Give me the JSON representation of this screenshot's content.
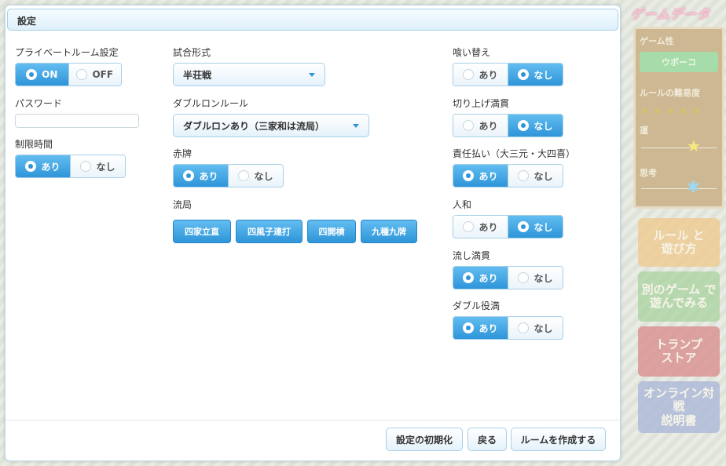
{
  "dialog": {
    "title": "設定"
  },
  "left": {
    "private_room": {
      "label": "プライベートルーム設定",
      "on": "ON",
      "off": "OFF",
      "selected": "ON"
    },
    "password": {
      "label": "パスワード",
      "value": "",
      "placeholder": ""
    },
    "time_limit": {
      "label": "制限時間",
      "yes": "あり",
      "no": "なし",
      "selected": "あり"
    }
  },
  "middle": {
    "match_format": {
      "label": "試合形式",
      "value": "半荘戦"
    },
    "double_ron": {
      "label": "ダブルロンルール",
      "value": "ダブルロンあり（三家和は流局）"
    },
    "red_tiles": {
      "label": "赤牌",
      "yes": "あり",
      "no": "なし",
      "selected": "あり"
    },
    "abortive_draw": {
      "label": "流局",
      "options": [
        "四家立直",
        "四風子連打",
        "四開槓",
        "九種九牌"
      ]
    }
  },
  "right": {
    "kuikae": {
      "label": "喰い替え",
      "yes": "あり",
      "no": "なし",
      "selected": "なし"
    },
    "kiriage_mangan": {
      "label": "切り上げ満貫",
      "yes": "あり",
      "no": "なし",
      "selected": "なし"
    },
    "liability": {
      "label": "責任払い（大三元・大四喜）",
      "yes": "あり",
      "no": "なし",
      "selected": "あり"
    },
    "renhou": {
      "label": "人和",
      "yes": "あり",
      "no": "なし",
      "selected": "なし"
    },
    "nagashi_mangan": {
      "label": "流し満貫",
      "yes": "あり",
      "no": "なし",
      "selected": "あり"
    },
    "double_yakuman": {
      "label": "ダブル役満",
      "yes": "あり",
      "no": "なし",
      "selected": "あり"
    }
  },
  "footer": {
    "reset": "設定の初期化",
    "back": "戻る",
    "create": "ルームを作成する"
  },
  "sidebar": {
    "title": "ゲームデータ",
    "game_type_label": "ゲーム性",
    "game_type_value": "ウボーコ",
    "rule_difficulty_label": "ルールの難易度",
    "stars": "★★★★★",
    "luck_label": "運",
    "thinking_label": "思考",
    "nav": [
      {
        "line1": "ルール と",
        "line2": "遊び方",
        "color": "#f0c98a"
      },
      {
        "line1": "別のゲーム で",
        "line2": "遊んでみる",
        "color": "#a9d4a0"
      },
      {
        "line1": "トランプ",
        "line2": "ストア",
        "color": "#d98a8a"
      },
      {
        "line1": "オンライン対戦",
        "line2": "説明書",
        "color": "#a8b6d8"
      }
    ]
  },
  "colors": {
    "accent": "#2e95d9",
    "border": "#a7cfe8",
    "side_panel": "#cdb893"
  }
}
